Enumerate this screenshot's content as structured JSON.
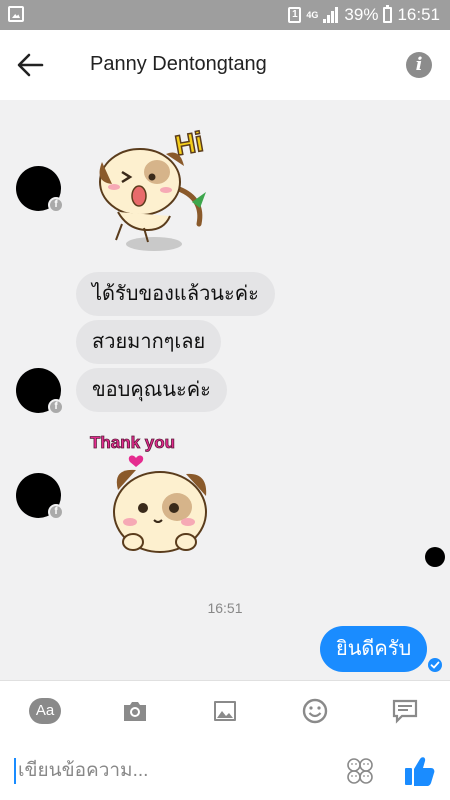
{
  "status_bar": {
    "sim": "1",
    "network": "4G",
    "battery": "39%",
    "time": "16:51"
  },
  "header": {
    "contact_name": "Panny Dentongtang",
    "info_icon": "info-icon"
  },
  "messages": {
    "received": [
      "ได้รับของแล้วนะค่ะ",
      "สวยมากๆเลย",
      "ขอบคุณนะค่ะ"
    ],
    "sticker_hi_text": "Hi",
    "sticker_thanks_text": "Thank you",
    "timestamp": "16:51",
    "sent": "ยินดีครับ"
  },
  "toolbar": {
    "text_label": "Aa",
    "icons": [
      "camera-icon",
      "image-icon",
      "emoji-icon",
      "reply-icon"
    ]
  },
  "composer": {
    "placeholder": "เขียนข้อความ..."
  },
  "colors": {
    "accent": "#1a8cff",
    "bubble_received": "#e4e4e6",
    "background": "#f1f1f2"
  }
}
